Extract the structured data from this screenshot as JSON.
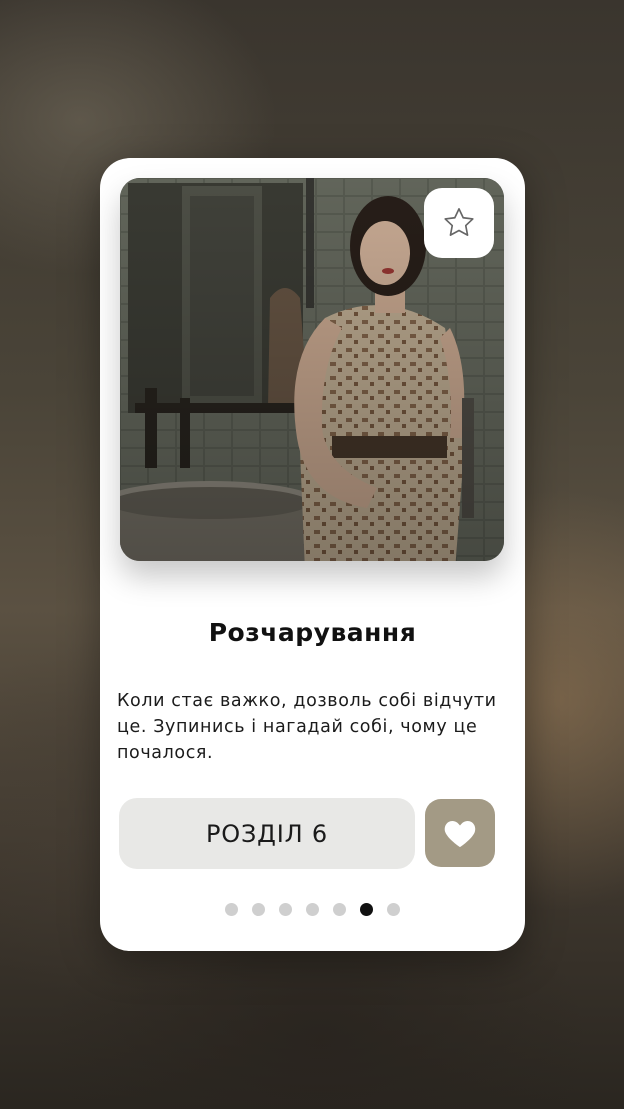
{
  "card": {
    "title": "Розчарування",
    "description": "Коли стає важко, дозволь собі відчути це. Зупинись і нагадай собі, чому це почалося.",
    "chapter_label": "РОЗДІЛ 6",
    "favorite_icon": "star-outline-icon",
    "like_icon": "heart-icon",
    "accent_color": "#a39a85"
  },
  "pagination": {
    "total": 7,
    "active_index": 5
  }
}
